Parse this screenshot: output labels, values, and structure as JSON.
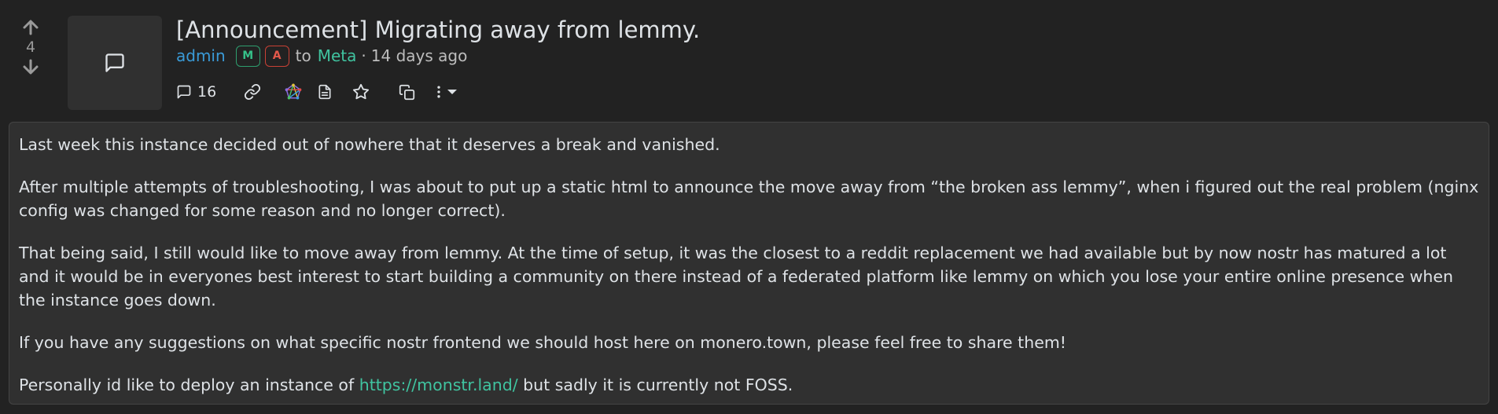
{
  "post": {
    "score": "4",
    "title": "[Announcement] Migrating away from lemmy.",
    "author": "admin",
    "badges": {
      "moderator": "M",
      "admin": "A"
    },
    "to_label": "to",
    "community": "Meta",
    "separator": "·",
    "time_ago": "14 days ago",
    "comment_count": "16"
  },
  "body": {
    "p1": "Last week this instance decided out of nowhere that it deserves a break and vanished.",
    "p2": "After multiple attempts of troubleshooting, I was about to put up a static html to announce the move away from “the broken ass lemmy”, when i figured out the real problem (nginx config was changed for some reason and no longer correct).",
    "p3": "That being said, I still would like to move away from lemmy. At the time of setup, it was the closest to a reddit replacement we had available but by now nostr has matured a lot and it would be in everyones best interest to start building a community on there instead of a federated platform like lemmy on which you lose your entire online presence when the instance goes down.",
    "p4": "If you have any suggestions on what specific nostr frontend we should host here on monero.town, please feel free to share them!",
    "p5_before": "Personally id like to deploy an instance of ",
    "p5_link": "https://monstr.land/",
    "p5_after": " but sadly it is currently not FOSS."
  },
  "colors": {
    "background": "#222222",
    "card": "#303030",
    "text": "#dee2e6",
    "author": "#3a9bd8",
    "community": "#40c4a0",
    "mod_badge": "#36c089",
    "admin_badge": "#e2584a"
  },
  "icons": {
    "upvote": "arrow-up-icon",
    "downvote": "arrow-down-icon",
    "thumbnail": "message-square-icon",
    "comments": "message-square-icon",
    "link": "link-icon",
    "fediverse": "fediverse-icon",
    "view_source": "file-text-icon",
    "save": "star-icon",
    "crosspost": "copy-icon",
    "more": "more-vertical-icon",
    "dropdown": "caret-down-icon"
  }
}
